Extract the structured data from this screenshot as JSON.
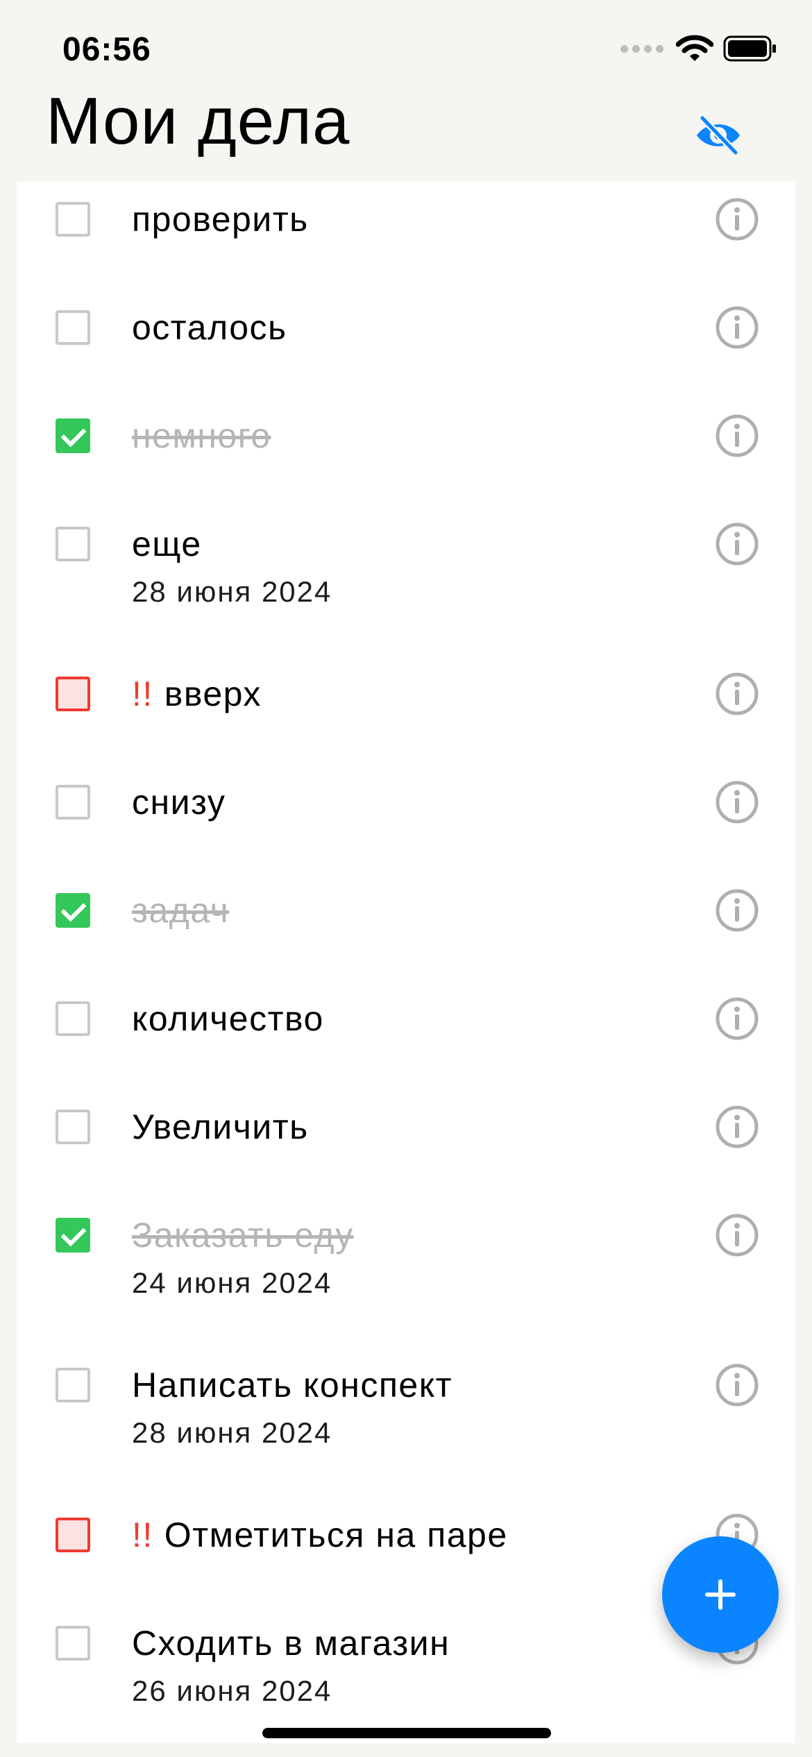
{
  "status_bar": {
    "time": "06:56",
    "wifi_icon": "wifi-icon",
    "battery_icon": "battery-full-icon"
  },
  "header": {
    "title": "Мои дела",
    "toggle_icon": "eye-slash-icon",
    "accent": "#0A84FF"
  },
  "todos": [
    {
      "title": "проверить",
      "done": false,
      "important": false,
      "date": null
    },
    {
      "title": "осталось",
      "done": false,
      "important": false,
      "date": null
    },
    {
      "title": "немного",
      "done": true,
      "important": false,
      "date": null
    },
    {
      "title": "еще",
      "done": false,
      "important": false,
      "date": "28 июня 2024"
    },
    {
      "title": "вверх",
      "done": false,
      "important": true,
      "priority_mark": "!!",
      "date": null
    },
    {
      "title": "снизу",
      "done": false,
      "important": false,
      "date": null
    },
    {
      "title": "задач",
      "done": true,
      "important": false,
      "date": null
    },
    {
      "title": "количество",
      "done": false,
      "important": false,
      "date": null
    },
    {
      "title": "Увеличить",
      "done": false,
      "important": false,
      "date": null
    },
    {
      "title": "Заказать еду",
      "done": true,
      "important": false,
      "date": "24 июня 2024"
    },
    {
      "title": "Написать конспект",
      "done": false,
      "important": false,
      "date": "28 июня 2024"
    },
    {
      "title": "Отметиться на паре",
      "done": false,
      "important": true,
      "priority_mark": "!!",
      "date": null
    },
    {
      "title": "Сходить в магазин",
      "done": false,
      "important": false,
      "date": "26 июня 2024"
    }
  ],
  "row_icon": "info-circle-icon",
  "fab": {
    "icon": "plus-icon"
  },
  "colors": {
    "done": "#34C759",
    "important": "#EE3B30",
    "accent": "#0A84FF"
  }
}
